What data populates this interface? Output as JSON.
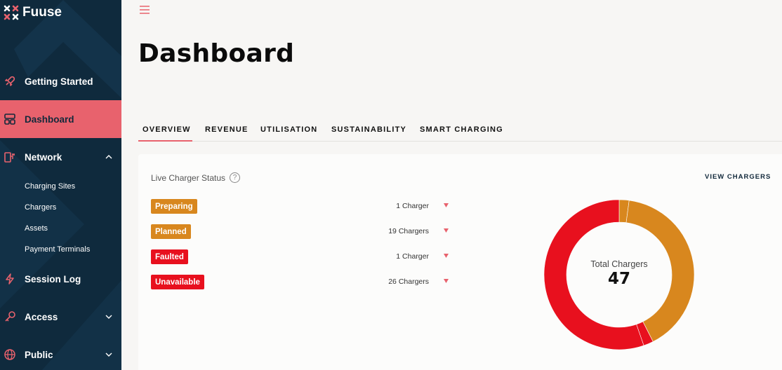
{
  "brand": {
    "name": "Fuuse"
  },
  "colors": {
    "sidebar": "#0f2a3d",
    "accent": "#e8626d",
    "orange": "#d8871e",
    "red": "#e8101e"
  },
  "sidebar": {
    "items": [
      {
        "label": "Getting Started",
        "icon": "rocket-icon"
      },
      {
        "label": "Dashboard",
        "icon": "dashboard-icon",
        "active": true
      },
      {
        "label": "Network",
        "icon": "network-icon",
        "expanded": true
      },
      {
        "label": "Session Log",
        "icon": "bolt-icon"
      },
      {
        "label": "Access",
        "icon": "key-icon"
      },
      {
        "label": "Public",
        "icon": "globe-icon"
      }
    ],
    "network_sub": [
      "Charging Sites",
      "Chargers",
      "Assets",
      "Payment Terminals"
    ]
  },
  "header": {
    "title": "Dashboard"
  },
  "tabs": [
    "OVERVIEW",
    "REVENUE",
    "UTILISATION",
    "SUSTAINABILITY",
    "SMART CHARGING"
  ],
  "card": {
    "title": "Live Charger Status",
    "help": "?",
    "view_link": "VIEW CHARGERS",
    "statuses": [
      {
        "label": "Preparing",
        "count": "1 Charger",
        "color": "#d8871e"
      },
      {
        "label": "Planned",
        "count": "19 Chargers",
        "color": "#d8871e"
      },
      {
        "label": "Faulted",
        "count": "1 Charger",
        "color": "#e8101e"
      },
      {
        "label": "Unavailable",
        "count": "26 Chargers",
        "color": "#e8101e"
      }
    ],
    "donut": {
      "label": "Total Chargers",
      "total": "47",
      "values": [
        1,
        19,
        1,
        26
      ]
    }
  }
}
